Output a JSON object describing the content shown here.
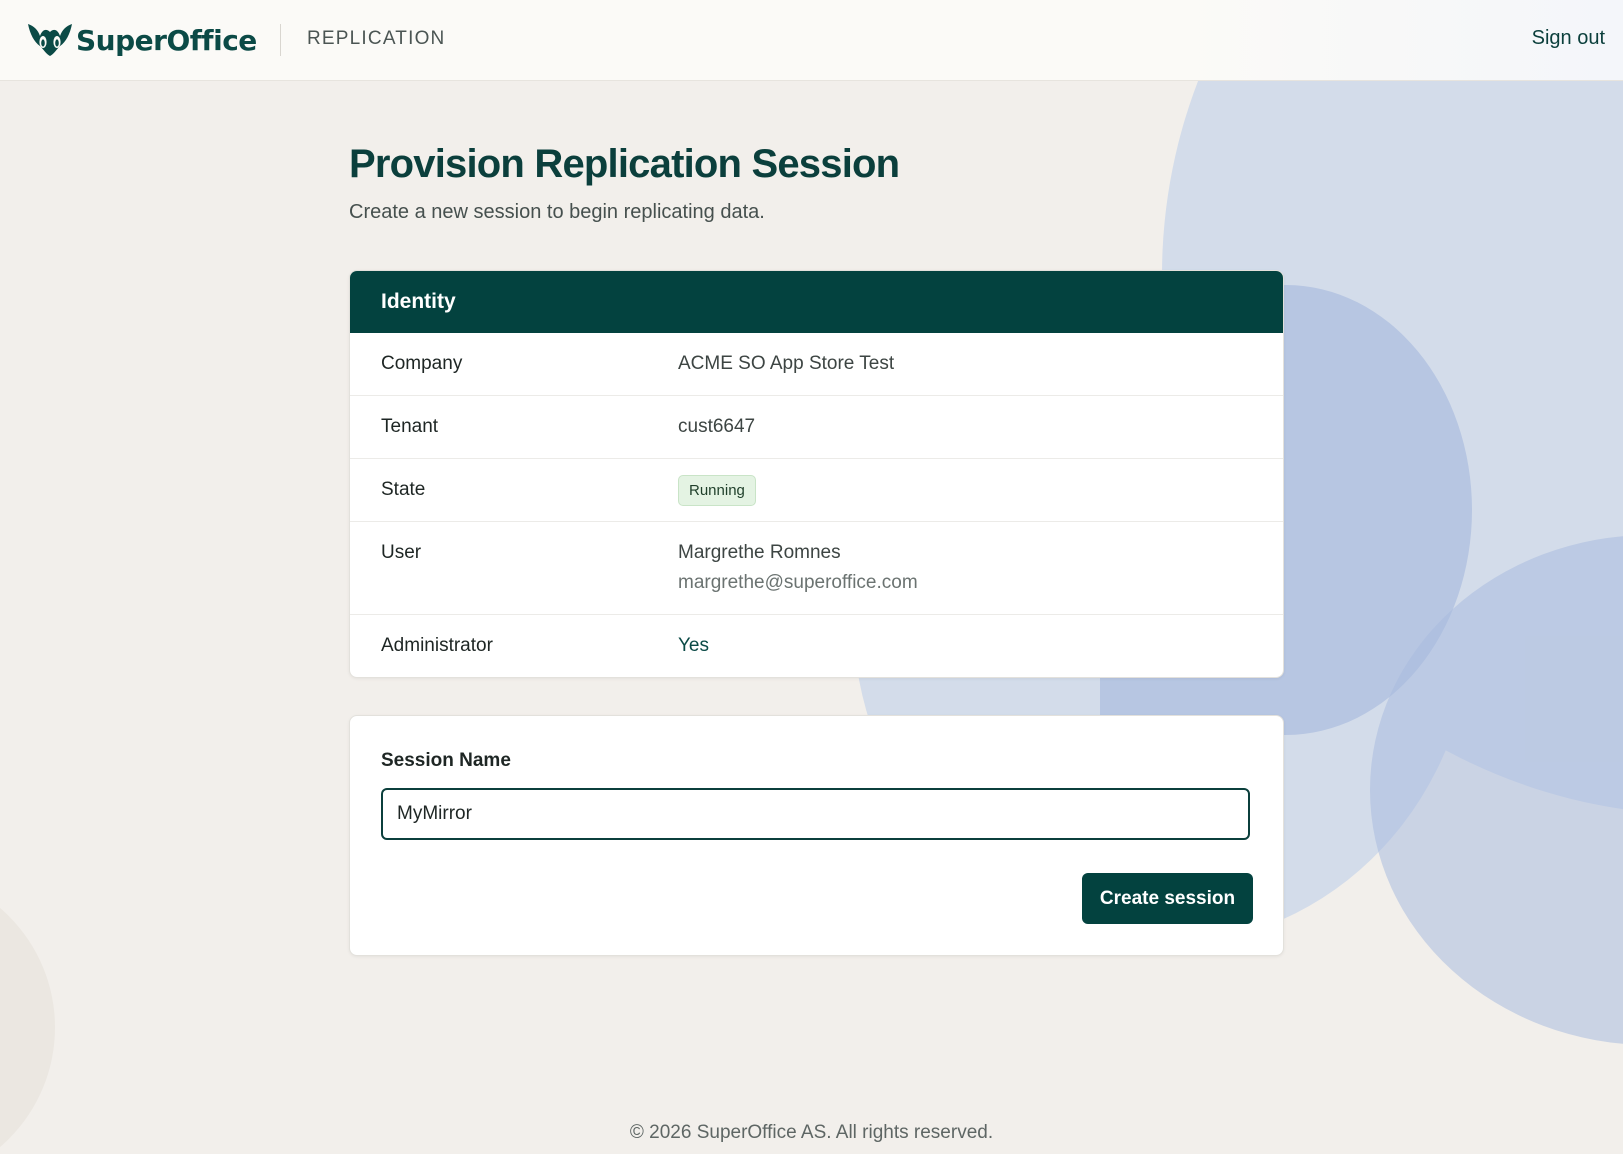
{
  "header": {
    "logo_text": "SuperOffice",
    "app_name": "REPLICATION",
    "sign_out_label": "Sign out"
  },
  "page": {
    "title": "Provision Replication Session",
    "subtitle": "Create a new session to begin replicating data."
  },
  "identity": {
    "header": "Identity",
    "rows": [
      {
        "label": "Company",
        "value": "ACME SO App Store Test"
      },
      {
        "label": "Tenant",
        "value": "cust6647"
      },
      {
        "label": "State",
        "value": "Running"
      },
      {
        "label": "User",
        "value": "Margrethe Romnes",
        "secondary": "margrethe@superoffice.com"
      },
      {
        "label": "Administrator",
        "value": "Yes"
      }
    ]
  },
  "session": {
    "field_label": "Session Name",
    "input_value": "MyMirror",
    "create_button_label": "Create session"
  },
  "footer": {
    "text": "© 2026 SuperOffice AS. All rights reserved."
  },
  "colors": {
    "brand": "#03423f",
    "background": "#f2efeb",
    "decor_blue": "#d3dcea",
    "badge_bg": "#e4f3e3"
  },
  "icons": {
    "logo": "superoffice-owl-icon"
  }
}
